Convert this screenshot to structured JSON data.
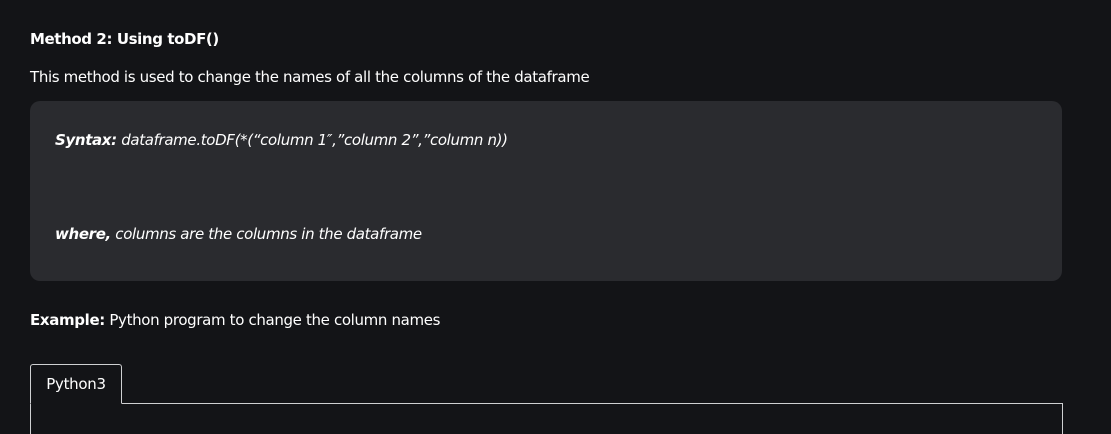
{
  "heading": "Method 2: Using toDF()",
  "intro": "This method is used to change the names of all the columns of the dataframe",
  "syntax": {
    "label": "Syntax:",
    "code": " dataframe.toDF(*(“column 1″,”column 2”,”column n))"
  },
  "where": {
    "label": "where,",
    "text": " columns are the columns in the dataframe"
  },
  "example": {
    "label": "Example:",
    "text": " Python program to change the column names"
  },
  "code_tabs": [
    "Python3"
  ],
  "colors": {
    "background": "#131417",
    "box": "#2a2b2f",
    "text": "#ffffff",
    "tab_border": "#cfd0d2"
  }
}
